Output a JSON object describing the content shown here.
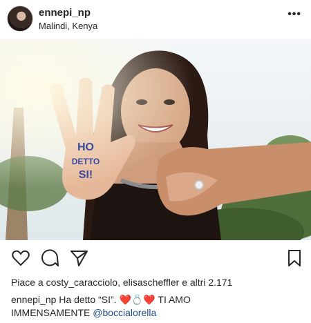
{
  "post": {
    "username": "ennepi_np",
    "location": "Malindi, Kenya",
    "more_label": "•••",
    "photo_text": [
      "HO",
      "DETTO",
      "SI!"
    ]
  },
  "actions": {
    "icons": [
      "heart-icon",
      "comment-icon",
      "share-icon",
      "bookmark-icon"
    ]
  },
  "likes": {
    "prefix": "Piace a",
    "users": "costy_caracciolo, elisascheffler",
    "conj": "e",
    "others": "altri 2.171"
  },
  "caption": {
    "author": "ennepi_np",
    "text1": "Ha detto “SI”.",
    "emoji": [
      "❤️",
      "💍",
      "❤️"
    ],
    "text2": "TI AMO",
    "text3": "IMMENSAMENTE",
    "mention": "@boccialorella"
  },
  "colors": {
    "heart": "#e0283a",
    "mention": "#1e4c8c"
  }
}
